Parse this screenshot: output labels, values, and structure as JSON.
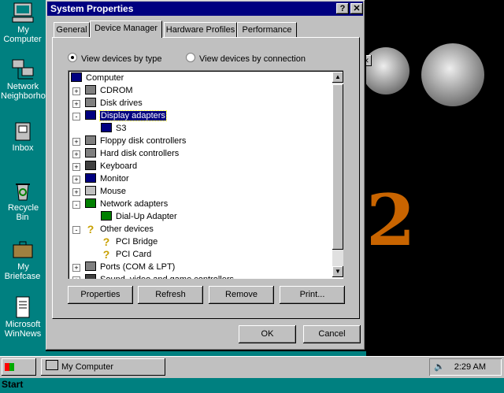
{
  "desktop": {
    "icons": [
      {
        "label": "My Computer"
      },
      {
        "label": "Network Neighborhood"
      },
      {
        "label": "Inbox"
      },
      {
        "label": "Recycle Bin"
      },
      {
        "label": "My Briefcase"
      },
      {
        "label": "Microsoft WinNews"
      }
    ]
  },
  "window": {
    "title": "System Properties",
    "help_label": "?",
    "close_label": "✕",
    "tabs": [
      {
        "label": "General"
      },
      {
        "label": "Device Manager"
      },
      {
        "label": "Hardware Profiles"
      },
      {
        "label": "Performance"
      }
    ],
    "view_options": {
      "by_type": "View devices by type",
      "by_connection": "View devices by connection",
      "selected": "by_type"
    },
    "tree": [
      {
        "label": "Computer",
        "level": 0,
        "expander": "",
        "icon": "computer-icon"
      },
      {
        "label": "CDROM",
        "level": 1,
        "expander": "+",
        "icon": "cdrom-icon"
      },
      {
        "label": "Disk drives",
        "level": 1,
        "expander": "+",
        "icon": "disk-drive-icon"
      },
      {
        "label": "Display adapters",
        "level": 1,
        "expander": "-",
        "icon": "monitor-icon",
        "selected": true
      },
      {
        "label": "S3",
        "level": 2,
        "expander": "",
        "icon": "monitor-icon"
      },
      {
        "label": "Floppy disk controllers",
        "level": 1,
        "expander": "+",
        "icon": "floppy-controller-icon"
      },
      {
        "label": "Hard disk controllers",
        "level": 1,
        "expander": "+",
        "icon": "hard-disk-controller-icon"
      },
      {
        "label": "Keyboard",
        "level": 1,
        "expander": "+",
        "icon": "keyboard-icon"
      },
      {
        "label": "Monitor",
        "level": 1,
        "expander": "+",
        "icon": "monitor-icon"
      },
      {
        "label": "Mouse",
        "level": 1,
        "expander": "+",
        "icon": "mouse-icon"
      },
      {
        "label": "Network adapters",
        "level": 1,
        "expander": "-",
        "icon": "network-adapter-icon"
      },
      {
        "label": "Dial-Up Adapter",
        "level": 2,
        "expander": "",
        "icon": "network-adapter-icon"
      },
      {
        "label": "Other devices",
        "level": 1,
        "expander": "-",
        "icon": "question-icon"
      },
      {
        "label": "PCI Bridge",
        "level": 2,
        "expander": "",
        "icon": "question-icon"
      },
      {
        "label": "PCI Card",
        "level": 2,
        "expander": "",
        "icon": "question-icon"
      },
      {
        "label": "Ports (COM & LPT)",
        "level": 1,
        "expander": "+",
        "icon": "port-icon"
      },
      {
        "label": "Sound, video and game controllers",
        "level": 1,
        "expander": "+",
        "icon": "sound-icon"
      }
    ],
    "buttons": {
      "properties": "Properties",
      "refresh": "Refresh",
      "remove": "Remove",
      "print": "Print..."
    },
    "ok": "OK",
    "cancel": "Cancel"
  },
  "taskbar": {
    "start": "Start",
    "task_item": "My Computer",
    "clock": "2:29 AM"
  },
  "colors": {
    "desktop": "#008080",
    "title_bar": "#000080",
    "selection": "#000080",
    "face": "#c0c0c0"
  }
}
